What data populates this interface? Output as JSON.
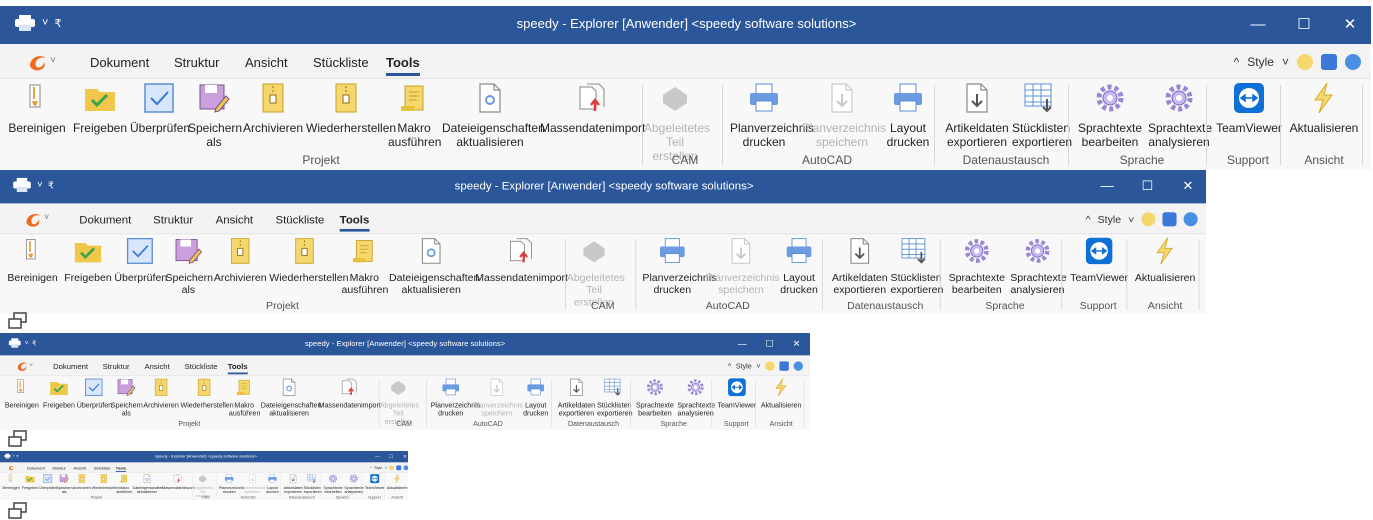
{
  "window": {
    "title": "speedy - Explorer [Anwender] <speedy software solutions>",
    "minimize_glyph": "—",
    "maximize_glyph": "☐",
    "close_glyph": "✕"
  },
  "menu": {
    "tabs": [
      "Dokument",
      "Struktur",
      "Ansicht",
      "Stückliste",
      "Tools"
    ],
    "active_tab": "Tools",
    "style_label": "Style",
    "style_prefix": "^",
    "style_chevron": "˅"
  },
  "ribbon": {
    "buttons": [
      {
        "label": "Bereinigen",
        "icon": "brush-icon"
      },
      {
        "label": "Freigeben",
        "icon": "folder-check-icon"
      },
      {
        "label": "Überprüfen",
        "icon": "checkbox-icon"
      },
      {
        "label": "Speichern\nals",
        "icon": "save-as-icon"
      },
      {
        "label": "Archivieren",
        "icon": "archive-zip-icon"
      },
      {
        "label": "Wiederherstellen",
        "icon": "restore-zip-icon"
      },
      {
        "label": "Makro\nausführen",
        "icon": "scroll-macro-icon"
      },
      {
        "label": "Dateieigenschaften\naktualisieren",
        "icon": "file-properties-icon"
      },
      {
        "label": "Massendatenimport",
        "icon": "mass-import-icon"
      },
      {
        "label": "Abgeleitetes\nTeil erstellen",
        "icon": "derived-part-icon",
        "disabled": true
      },
      {
        "label": "Planverzeichnis\ndrucken",
        "icon": "printer-icon"
      },
      {
        "label": "Planverzeichnis\nspeichern",
        "icon": "file-download-icon",
        "disabled": true
      },
      {
        "label": "Layout\ndrucken",
        "icon": "printer-icon"
      },
      {
        "label": "Artikeldaten\nexportieren",
        "icon": "file-export-icon"
      },
      {
        "label": "Stücklisten\nexportieren",
        "icon": "table-export-icon"
      },
      {
        "label": "Sprachtexte\nbearbeiten",
        "icon": "gear-icon"
      },
      {
        "label": "Sprachtexte\nanalysieren",
        "icon": "gear-icon"
      },
      {
        "label": "TeamViewer",
        "icon": "teamviewer-icon"
      },
      {
        "label": "Aktualisieren",
        "icon": "lightning-icon"
      }
    ],
    "groups": [
      "Projekt",
      "CAM",
      "AutoCAD",
      "Datenaustausch",
      "Sprache",
      "Support",
      "Ansicht"
    ]
  },
  "colors": {
    "titlebar": "#2b579a",
    "accent": "#2b579a",
    "logo": "#f26b1d",
    "folder": "#f0c74a",
    "check": "#3aa64a",
    "info": "#3b78d8",
    "help": "#4a90e2"
  }
}
